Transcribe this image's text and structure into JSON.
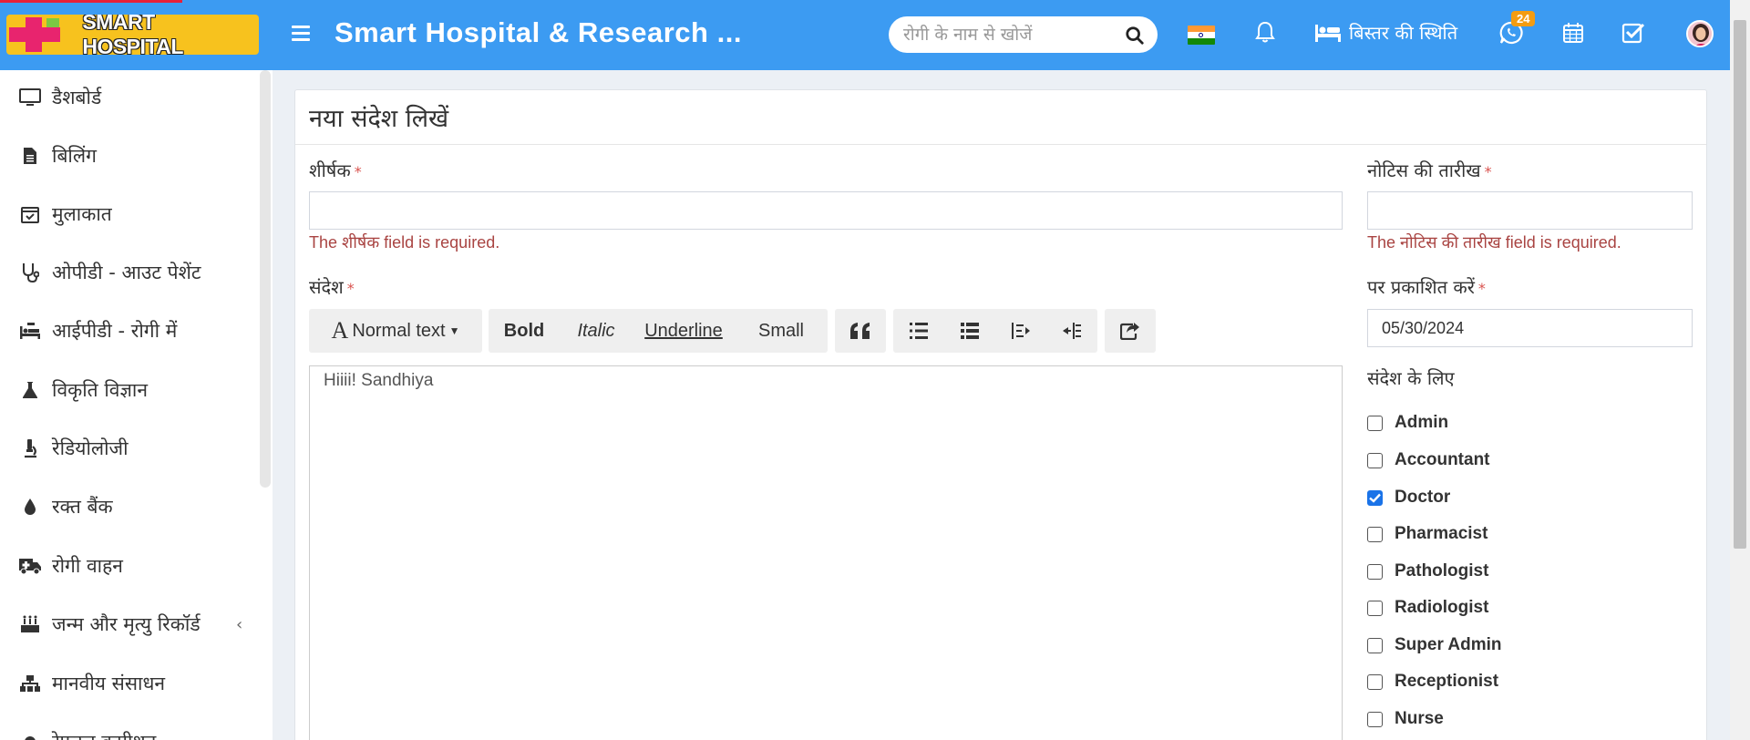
{
  "header": {
    "logo_text": "SMART HOSPITAL",
    "title": "Smart Hospital & Research ...",
    "search_placeholder": "रोगी के नाम से खोजें",
    "bed_status_label": "बिस्तर की स्थिति",
    "whatsapp_badge": "24",
    "colors": {
      "bar": "#3c9bf2",
      "logo_bg": "#f7c21e",
      "logo_cross": "#e8246e",
      "badge": "#f39c12"
    }
  },
  "sidebar": {
    "items": [
      {
        "label": "डैशबोर्ड",
        "icon": "monitor-icon"
      },
      {
        "label": "बिलिंग",
        "icon": "file-invoice-icon"
      },
      {
        "label": "मुलाकात",
        "icon": "calendar-check-icon"
      },
      {
        "label": "ओपीडी - आउट पेशेंट",
        "icon": "stethoscope-icon"
      },
      {
        "label": "आईपीडी - रोगी में",
        "icon": "procedures-icon"
      },
      {
        "label": "विकृति विज्ञान",
        "icon": "flask-icon"
      },
      {
        "label": "रेडियोलोजी",
        "icon": "microscope-icon"
      },
      {
        "label": "रक्त बैंक",
        "icon": "tint-icon"
      },
      {
        "label": "रोगी वाहन",
        "icon": "ambulance-icon"
      },
      {
        "label": "जन्म और मृत्यु रिकॉर्ड",
        "icon": "birthday-cake-icon"
      },
      {
        "label": "मानवीय संसाधन",
        "icon": "sitemap-icon"
      },
      {
        "label": "रेफरल कमीशन",
        "icon": "more-icon"
      }
    ]
  },
  "form": {
    "panel_title": "नया संदेश लिखें",
    "title_label": "शीर्षक",
    "title_value": "",
    "title_error": "The शीर्षक field is required.",
    "notice_date_label": "नोटिस की तारीख",
    "notice_date_value": "",
    "notice_date_error": "The नोटिस की तारीख field is required.",
    "message_label": "संदेश",
    "publish_on_label": "पर प्रकाशित करें",
    "publish_on_value": "05/30/2024",
    "message_to_label": "संदेश के लिए",
    "required_mark": "*",
    "editor_text": "Hiiii! Sandhiya",
    "toolbar": {
      "font_letter": "A",
      "text_style": "Normal text",
      "bold": "Bold",
      "italic": "Italic",
      "underline": "Underline",
      "small": "Small"
    },
    "roles": [
      {
        "label": "Admin",
        "checked": false
      },
      {
        "label": "Accountant",
        "checked": false
      },
      {
        "label": "Doctor",
        "checked": true
      },
      {
        "label": "Pharmacist",
        "checked": false
      },
      {
        "label": "Pathologist",
        "checked": false
      },
      {
        "label": "Radiologist",
        "checked": false
      },
      {
        "label": "Super Admin",
        "checked": false
      },
      {
        "label": "Receptionist",
        "checked": false
      },
      {
        "label": "Nurse",
        "checked": false
      }
    ]
  }
}
